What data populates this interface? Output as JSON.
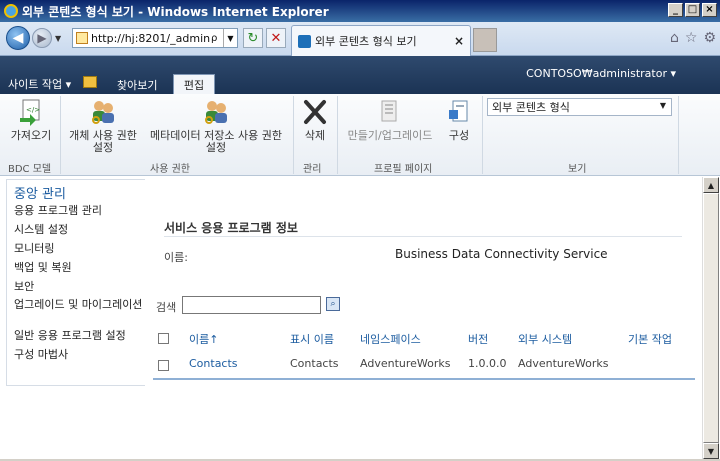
{
  "window": {
    "title": "외부 콘텐츠 형식 보기 - Windows Internet Explorer",
    "controls": [
      "_",
      "□",
      "×"
    ]
  },
  "browser": {
    "address": "http://hj:8201/_admin,",
    "address_search_glyph": "ρ",
    "tab_title": "외부 콘텐츠 형식 보기",
    "tab_close": "×",
    "icons": [
      "back-arrow-icon",
      "forward-arrow-icon",
      "refresh-icon",
      "stop-icon",
      "home-icon",
      "favorites-star-icon",
      "tools-gear-icon"
    ]
  },
  "sharepoint": {
    "site_actions": "사이트 작업 ▾",
    "tabs": {
      "browse": "찾아보기",
      "edit": "편집"
    },
    "user": "CONTOSO₩administrator ▾"
  },
  "ribbon": {
    "buttons": {
      "import": "가져오기",
      "object_permissions": "개체 사용 권한\n설정",
      "metadata_permissions": "메타데이터 저장소 사용 권한\n설정",
      "delete": "삭제",
      "create_upgrade": "만들기/업그레이드",
      "configure": "구성"
    },
    "groups": {
      "bdc_models": "BDC 모델",
      "permissions": "사용 권한",
      "manage": "관리",
      "profile_pages": "프로필 페이지",
      "view": "보기"
    },
    "view_select": "외부 콘텐츠 형식"
  },
  "leftnav": {
    "heading": "중앙 관리",
    "items": [
      "응용 프로그램 관리",
      "시스템 설정",
      "모니터링",
      "백업 및 복원",
      "보안",
      "업그레이드 및 마이그레이션",
      "일반 응용 프로그램 설정",
      "구성 마법사"
    ]
  },
  "main": {
    "section_title": "서비스 응용 프로그램 정보",
    "name_label": "이름:",
    "name_value": "Business Data Connectivity Service",
    "search_label": "검색",
    "search_value": "",
    "search_go_glyph": "⌕",
    "columns": [
      "이름↑",
      "표시 이름",
      "네임스페이스",
      "버전",
      "외부 시스템",
      "기본 작업"
    ],
    "rows": [
      {
        "name": "Contacts",
        "display_name": "Contacts",
        "namespace": "AdventureWorks",
        "version": "1.0.0.0",
        "external_system": "AdventureWorks",
        "default_action": ""
      }
    ]
  },
  "colors": {
    "title_bar": "#0a246a",
    "sharepoint_bar": "#1b3354",
    "link": "#1c5ca0",
    "grid_rule": "#8fb0d5"
  }
}
